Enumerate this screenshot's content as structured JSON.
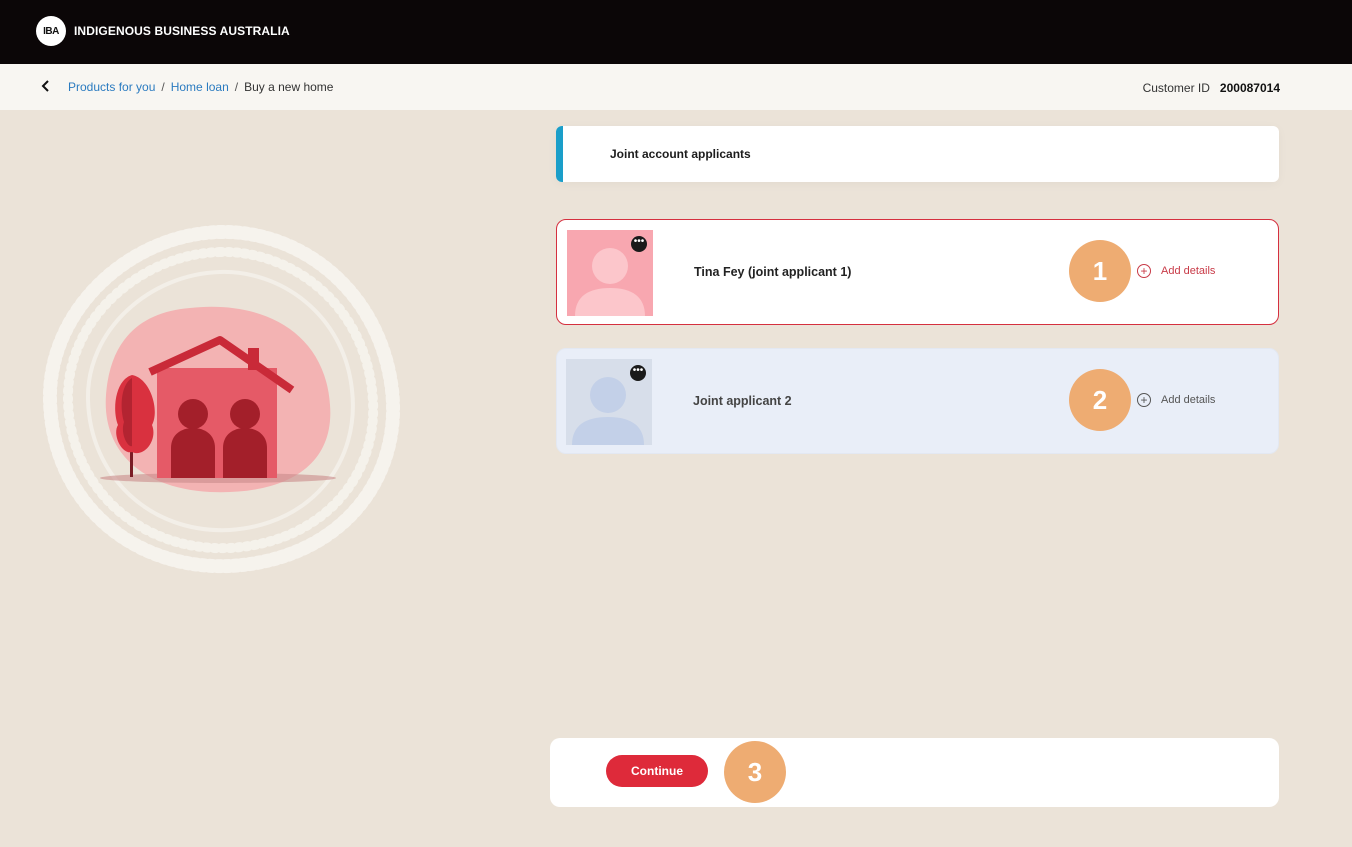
{
  "header": {
    "logo_text": "IBA",
    "brand_name": "INDIGENOUS BUSINESS AUSTRALIA"
  },
  "breadcrumb": {
    "items": [
      "Products for you",
      "Home loan"
    ],
    "separator": "/",
    "current": "Buy a new home"
  },
  "customer": {
    "label": "Customer ID",
    "id": "200087014"
  },
  "section": {
    "title": "Joint account applicants"
  },
  "applicants": [
    {
      "name": "Tina Fey (joint applicant 1)",
      "action": "Add details",
      "badge": "1"
    },
    {
      "name": "Joint applicant 2",
      "action": "Add details",
      "badge": "2"
    }
  ],
  "footer": {
    "continue_label": "Continue",
    "badge": "3"
  },
  "colors": {
    "accent_blue": "#1a9ec9",
    "brand_red": "#de2a3a",
    "badge_orange": "#eeac72"
  }
}
